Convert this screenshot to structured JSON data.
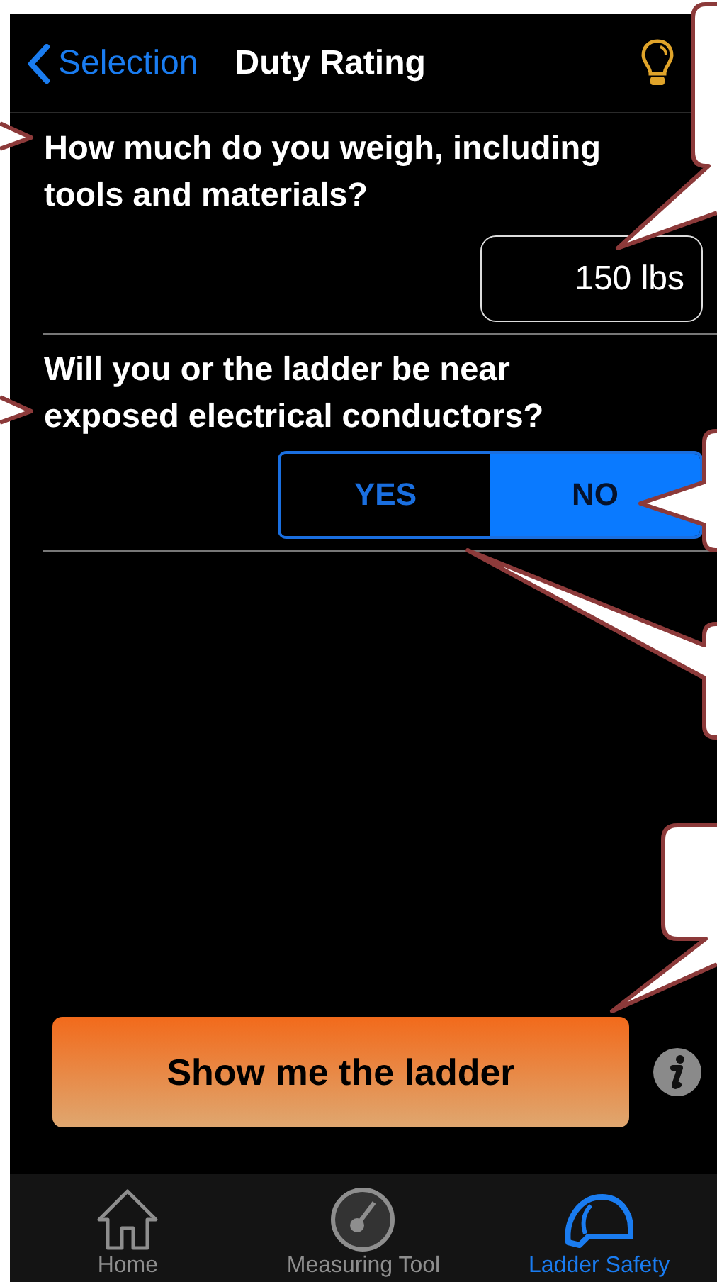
{
  "nav_bar": {
    "back_label": "Selection",
    "title": "Duty Rating"
  },
  "questions": [
    {
      "kind": "field",
      "text": "How much do you weigh, including tools and materials?",
      "value": "150 lbs"
    },
    {
      "kind": "segmented",
      "text": "Will you or the ladder be near exposed electrical conductors?",
      "options": [
        {
          "label": "YES",
          "selected": false
        },
        {
          "label": "NO",
          "selected": true
        }
      ]
    }
  ],
  "primary_button": {
    "label": "Show me the ladder"
  },
  "tab_bar": [
    {
      "label": "Home",
      "selected": false
    },
    {
      "label": "Measuring Tool",
      "selected": false
    },
    {
      "label": "Ladder Safety",
      "selected": true
    }
  ]
}
